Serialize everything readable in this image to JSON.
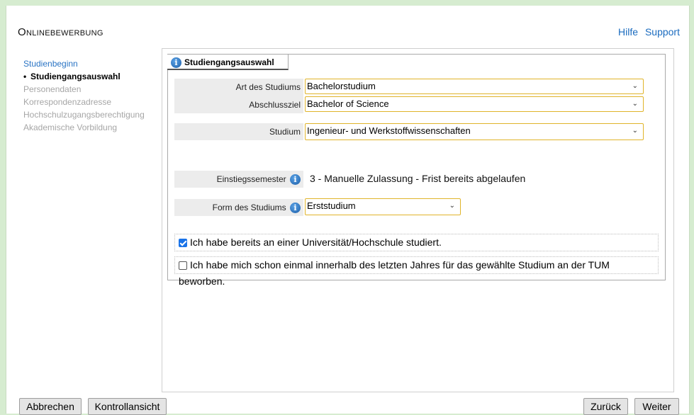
{
  "header": {
    "title": "Onlinebewerbung",
    "links": [
      "Hilfe",
      "Support"
    ]
  },
  "sidebar": {
    "items": [
      {
        "label": "Studienbeginn",
        "state": "link"
      },
      {
        "label": "Studiengangsauswahl",
        "state": "active"
      },
      {
        "label": "Personendaten",
        "state": "disabled"
      },
      {
        "label": "Korrespondenzadresse",
        "state": "disabled"
      },
      {
        "label": "Hochschulzugangsberechtigung",
        "state": "disabled"
      },
      {
        "label": "Akademische Vorbildung",
        "state": "disabled"
      }
    ]
  },
  "panel": {
    "tab_label": "Studiengangsauswahl",
    "fields": {
      "art": {
        "label": "Art des Studiums",
        "value": "Bachelorstudium"
      },
      "abschluss": {
        "label": "Abschlussziel",
        "value": "Bachelor of Science"
      },
      "studium": {
        "label": "Studium",
        "value": "Ingenieur- und Werkstoffwissenschaften"
      },
      "semester": {
        "label": "Einstiegssemester",
        "value": "3 - Manuelle Zulassung - Frist bereits abgelaufen"
      },
      "form": {
        "label": "Form des Studiums",
        "value": "Erststudium"
      }
    },
    "checkboxes": [
      {
        "label": "Ich habe bereits an einer Universität/Hochschule studiert.",
        "checked": true
      },
      {
        "label": "Ich habe mich schon einmal innerhalb des letzten Jahres für das gewählte Studium an der TUM beworben.",
        "checked": false
      }
    ]
  },
  "buttons": {
    "cancel": "Abbrechen",
    "review": "Kontrollansicht",
    "back": "Zurück",
    "next": "Weiter"
  },
  "colors": {
    "accent_border": "#e0b42a",
    "link": "#1a6bbf",
    "checkbox": "#1a73e8"
  }
}
